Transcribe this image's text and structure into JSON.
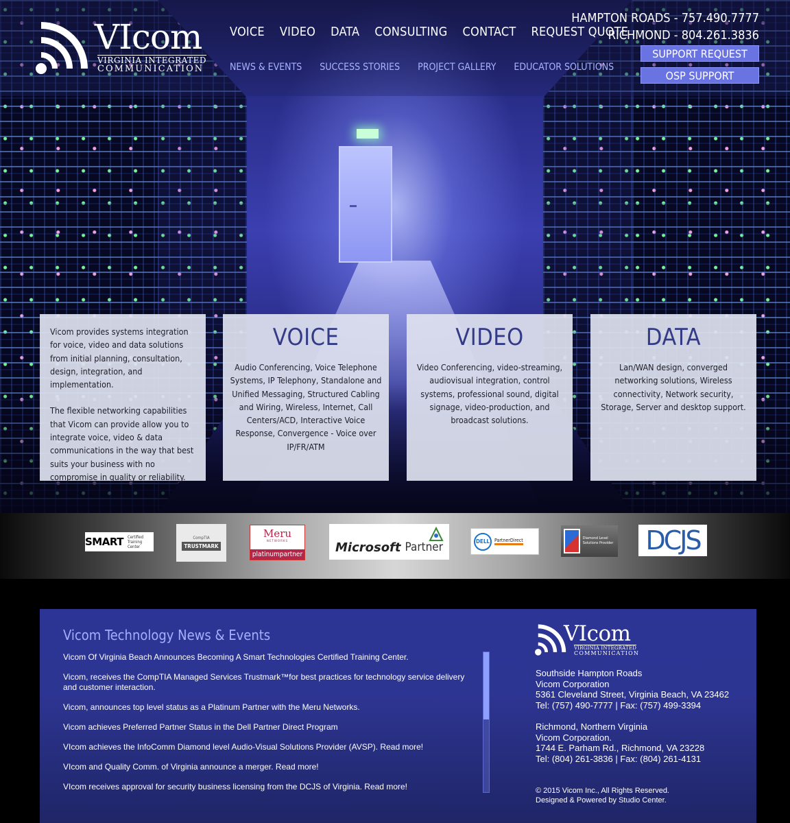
{
  "header": {
    "logo": {
      "brand": "VIcom",
      "line1": "VIRGINIA INTEGRATED",
      "line2": "COMMUNICATION"
    },
    "nav_main": [
      "VOICE",
      "VIDEO",
      "DATA",
      "CONSULTING",
      "CONTACT",
      "REQUEST QUOTE"
    ],
    "nav_sub": [
      "NEWS & EVENTS",
      "SUCCESS STORIES",
      "PROJECT GALLERY",
      "EDUCATOR SOLUTIONS"
    ],
    "phones": {
      "hampton": "HAMPTON ROADS - 757.490.7777",
      "richmond": "RICHMOND - 804.261.3836"
    },
    "support_request_label": "SUPPORT REQUEST",
    "osp_support_label": "OSP SUPPORT"
  },
  "panels": {
    "intro_p1": "Vicom provides systems integration for voice, video and data solutions from initial planning, consultation, design, integration, and implementation.",
    "intro_p2": "The flexible networking capabilities that Vicom can provide allow you to integrate voice, video & data communications in the way that best suits your business with no compromise in quality or reliability.",
    "voice": {
      "title": "VOICE",
      "text": "Audio Conferencing, Voice Telephone Systems, IP Telephony, Standalone and Unified Messaging, Structured Cabling and Wiring, Wireless, Internet, Call Centers/ACD, Interactive Voice Response, Convergence - Voice over IP/FR/ATM"
    },
    "video": {
      "title": "VIDEO",
      "text": "Video Conferencing, video-streaming, audiovisual integration, control systems, professional sound, digital signage, video-production, and broadcast solutions."
    },
    "data": {
      "title": "DATA",
      "text": "Lan/WAN design, converged networking solutions, Wireless connectivity, Network security, Storage, Server and desktop support."
    }
  },
  "partners": {
    "smart": {
      "name": "SMART",
      "sub": "Certified Training Center"
    },
    "comptia": {
      "top": "CompTIA",
      "mid": "TRUSTMARK"
    },
    "meru": {
      "name": "Meru",
      "networks": "NETWORKS",
      "tier": "platinumpartner"
    },
    "microsoft": {
      "name": "Microsoft",
      "tier": "Partner"
    },
    "dell": {
      "mark": "DELL",
      "text": "PartnerDirect"
    },
    "avsp": {
      "text": "Diamond Level Solutions Provider"
    },
    "dcjs": {
      "name": "DCJS"
    }
  },
  "footer": {
    "news_title": "Vicom Technology News & Events",
    "news": [
      "Vicom Of Virginia Beach Announces Becoming A Smart Technologies Certified Training Center.",
      "Vicom, receives the CompTIA Managed Services Trustmark™for best practices for technology service delivery and customer interaction.",
      "Vicom, announces top level status as a Platinum Partner with the Meru Networks.",
      "Vicom achieves Preferred Partner Status in the Dell Partner Direct Program",
      "VIcom achieves the InfoComm Diamond level Audio-Visual Solutions Provider (AVSP). Read more!",
      "VIcom and Quality Comm. of Virginia announce a merger. Read more!",
      "VIcom receives approval for security business licensing from the DCJS of Virginia. Read more!"
    ],
    "logo": {
      "brand": "VIcom",
      "line1": "VIRGINIA INTEGRATED",
      "line2": "COMMUNICATION"
    },
    "address1": {
      "region": "Southside Hampton Roads",
      "company": "Vicom Corporation",
      "street": "5361 Cleveland Street, Virginia Beach, VA 23462",
      "phones": "Tel: (757) 490-7777  |  Fax: (757) 499-3394"
    },
    "address2": {
      "region": "Richmond, Northern Virginia",
      "company": "Vicom Corporation.",
      "street": "1744 E. Parham Rd., Richmond, VA 23228",
      "phones": "Tel: (804) 261-3836  |  Fax: (804) 261-4131"
    },
    "copyright": "© 2015 Vicom Inc., All Rights Reserved.",
    "credits": "Designed & Powered by Studio Center."
  },
  "colors": {
    "accent": "#333a86",
    "nav_sub": "#a9b4ff",
    "button": "#6a73e2",
    "footer_bg": "#2c3595"
  },
  "news_scroll_position": 0.0
}
